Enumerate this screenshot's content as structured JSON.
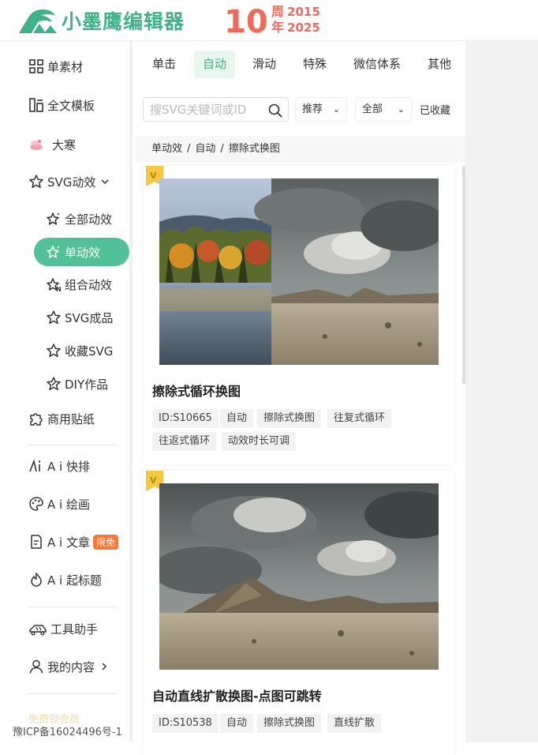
{
  "header": {
    "brand": "小墨鹰编辑器",
    "anniversary": {
      "number": "10",
      "line1_char": "周",
      "line1_year": "2015",
      "line2_char": "年",
      "line2_year": "2025"
    },
    "colors": {
      "brand": "#3fb28a",
      "anniversary": "#ee6b5a"
    }
  },
  "sidebar": {
    "items": [
      {
        "label": "单素材",
        "icon": "grid-icon"
      },
      {
        "label": "全文模板",
        "icon": "template-icon"
      },
      {
        "label": "大寒",
        "icon": "season-icon"
      },
      {
        "label": "SVG动效",
        "icon": "star-outline-icon",
        "expanded": true
      }
    ],
    "sub_items": [
      {
        "label": "全部动效",
        "icon": "star-sparkle-icon"
      },
      {
        "label": "单动效",
        "icon": "star-sparkle-icon",
        "active": true
      },
      {
        "label": "组合动效",
        "icon": "star-n-icon"
      },
      {
        "label": "SVG成品",
        "icon": "star-outline-icon"
      },
      {
        "label": "收藏SVG",
        "icon": "star-outline-icon"
      },
      {
        "label": "DIY作品",
        "icon": "star-edit-icon"
      }
    ],
    "items2": [
      {
        "label": "商用贴纸",
        "icon": "puzzle-icon"
      }
    ],
    "ai_items": [
      {
        "label": "A i 快排",
        "icon": "ai-icon"
      },
      {
        "label": "A i 绘画",
        "icon": "palette-icon"
      },
      {
        "label": "A i 文章",
        "icon": "doc-icon",
        "badge": "限免"
      },
      {
        "label": "A i 起标题",
        "icon": "flame-icon"
      }
    ],
    "tool_items": [
      {
        "label": "工具助手",
        "icon": "truck-icon"
      },
      {
        "label": "我的内容",
        "icon": "user-icon"
      }
    ],
    "faded_label": "免费领会员",
    "icp": "豫ICP备16024496号-1",
    "accent": "#52c19a",
    "badge_color": "#f77a38"
  },
  "main": {
    "tabs": [
      "单击",
      "自动",
      "滑动",
      "特殊",
      "微信体系",
      "其他"
    ],
    "active_tab": 1,
    "search": {
      "placeholder": "搜SVG关键词或ID",
      "value": ""
    },
    "filters": {
      "sort": "推荐",
      "scope": "全部",
      "favorites": "已收藏"
    },
    "breadcrumb": [
      "单动效",
      "自动",
      "擦除式换图"
    ],
    "cards": [
      {
        "title": "擦除式循环换图",
        "tags": [
          "ID:S10665",
          "自动",
          "擦除式换图",
          "往复式循环",
          "往返式循环",
          "动效时长可调"
        ]
      },
      {
        "title": "自动直线扩散换图-点图可跳转",
        "tags": [
          "ID:S10538",
          "自动",
          "擦除式换图",
          "直线扩散"
        ]
      }
    ]
  }
}
